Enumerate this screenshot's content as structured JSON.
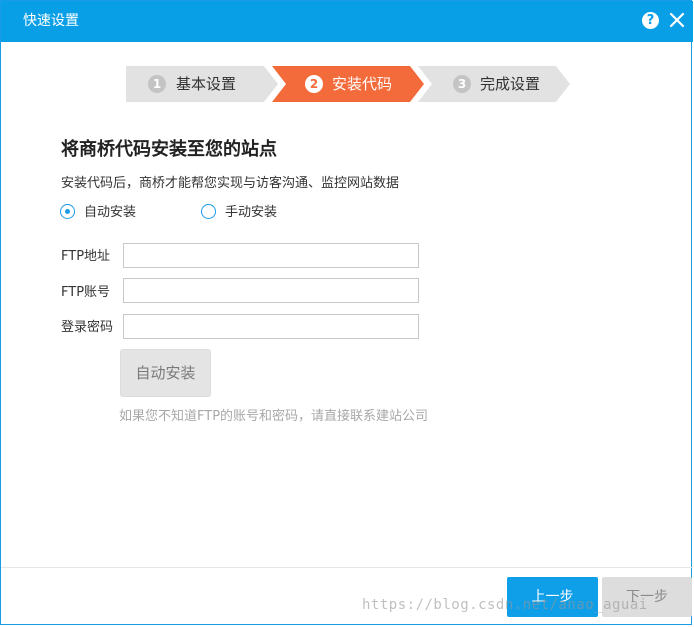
{
  "window": {
    "title": "快速设置"
  },
  "steps": [
    {
      "number": "1",
      "label": "基本设置",
      "state": "done"
    },
    {
      "number": "2",
      "label": "安装代码",
      "state": "active"
    },
    {
      "number": "3",
      "label": "完成设置",
      "state": "pending"
    }
  ],
  "content": {
    "heading": "将商桥代码安装至您的站点",
    "subtext": "安装代码后，商桥才能帮您实现与访客沟通、监控网站数据",
    "install_mode": {
      "options": [
        {
          "label": "自动安装",
          "selected": true
        },
        {
          "label": "手动安装",
          "selected": false
        }
      ]
    },
    "fields": [
      {
        "label": "FTP地址",
        "value": ""
      },
      {
        "label": "FTP账号",
        "value": ""
      },
      {
        "label": "登录密码",
        "value": ""
      }
    ],
    "auto_install_button": "自动安装",
    "hint": "如果您不知道FTP的账号和密码，请直接联系建站公司"
  },
  "footer": {
    "prev_button": "上一步",
    "next_button": "下一步"
  },
  "watermark": "https://blog.csdn.net/anao_aguai",
  "colors": {
    "titlebar": "#099fe6",
    "active_step": "#f46b3b",
    "inactive_step": "#e2e2e2",
    "primary_button": "#0f9fe9"
  },
  "icons": {
    "help": "question-circle-icon",
    "close": "close-icon"
  }
}
